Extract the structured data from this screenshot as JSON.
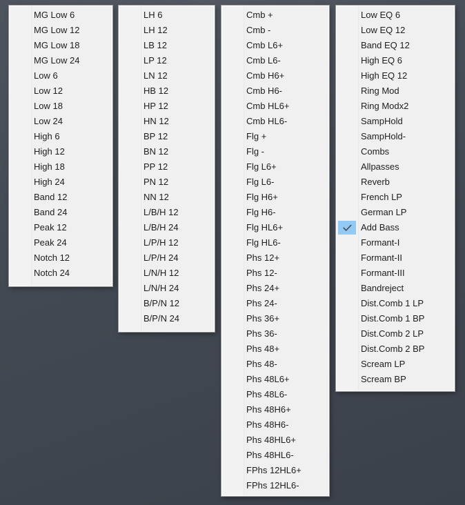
{
  "theme": {
    "background_color": "#434a53",
    "panel_background": "#f0f0f0",
    "panel_border": "#ffffff",
    "text_color": "#1d1d20",
    "check_highlight": "#91c9f7",
    "check_glyph_color": "#4a4a4a"
  },
  "menus": [
    {
      "name": "filters-basic",
      "items": [
        {
          "label": "MG Low 6",
          "checked": false
        },
        {
          "label": "MG Low 12",
          "checked": false
        },
        {
          "label": "MG Low 18",
          "checked": false
        },
        {
          "label": "MG Low 24",
          "checked": false
        },
        {
          "label": "Low 6",
          "checked": false
        },
        {
          "label": "Low 12",
          "checked": false
        },
        {
          "label": "Low 18",
          "checked": false
        },
        {
          "label": "Low 24",
          "checked": false
        },
        {
          "label": "High 6",
          "checked": false
        },
        {
          "label": "High 12",
          "checked": false
        },
        {
          "label": "High 18",
          "checked": false
        },
        {
          "label": "High 24",
          "checked": false
        },
        {
          "label": "Band 12",
          "checked": false
        },
        {
          "label": "Band 24",
          "checked": false
        },
        {
          "label": "Peak 12",
          "checked": false
        },
        {
          "label": "Peak 24",
          "checked": false
        },
        {
          "label": "Notch 12",
          "checked": false
        },
        {
          "label": "Notch 24",
          "checked": false
        }
      ]
    },
    {
      "name": "filters-multi",
      "items": [
        {
          "label": "LH 6",
          "checked": false
        },
        {
          "label": "LH 12",
          "checked": false
        },
        {
          "label": "LB 12",
          "checked": false
        },
        {
          "label": "LP 12",
          "checked": false
        },
        {
          "label": "LN 12",
          "checked": false
        },
        {
          "label": "HB 12",
          "checked": false
        },
        {
          "label": "HP 12",
          "checked": false
        },
        {
          "label": "HN 12",
          "checked": false
        },
        {
          "label": "BP 12",
          "checked": false
        },
        {
          "label": "BN 12",
          "checked": false
        },
        {
          "label": "PP 12",
          "checked": false
        },
        {
          "label": "PN 12",
          "checked": false
        },
        {
          "label": "NN 12",
          "checked": false
        },
        {
          "label": "L/B/H 12",
          "checked": false
        },
        {
          "label": "L/B/H 24",
          "checked": false
        },
        {
          "label": "L/P/H 12",
          "checked": false
        },
        {
          "label": "L/P/H 24",
          "checked": false
        },
        {
          "label": "L/N/H 12",
          "checked": false
        },
        {
          "label": "L/N/H 24",
          "checked": false
        },
        {
          "label": "B/P/N 12",
          "checked": false
        },
        {
          "label": "B/P/N 24",
          "checked": false
        }
      ]
    },
    {
      "name": "comb-phaser",
      "items": [
        {
          "label": "Cmb +",
          "checked": false
        },
        {
          "label": "Cmb -",
          "checked": false
        },
        {
          "label": "Cmb L6+",
          "checked": false
        },
        {
          "label": "Cmb L6-",
          "checked": false
        },
        {
          "label": "Cmb H6+",
          "checked": false
        },
        {
          "label": "Cmb H6-",
          "checked": false
        },
        {
          "label": "Cmb HL6+",
          "checked": false
        },
        {
          "label": "Cmb HL6-",
          "checked": false
        },
        {
          "label": "Flg +",
          "checked": false
        },
        {
          "label": "Flg -",
          "checked": false
        },
        {
          "label": "Flg L6+",
          "checked": false
        },
        {
          "label": "Flg L6-",
          "checked": false
        },
        {
          "label": "Flg H6+",
          "checked": false
        },
        {
          "label": "Flg H6-",
          "checked": false
        },
        {
          "label": "Flg HL6+",
          "checked": false
        },
        {
          "label": "Flg HL6-",
          "checked": false
        },
        {
          "label": "Phs 12+",
          "checked": false
        },
        {
          "label": "Phs 12-",
          "checked": false
        },
        {
          "label": "Phs 24+",
          "checked": false
        },
        {
          "label": "Phs 24-",
          "checked": false
        },
        {
          "label": "Phs 36+",
          "checked": false
        },
        {
          "label": "Phs 36-",
          "checked": false
        },
        {
          "label": "Phs 48+",
          "checked": false
        },
        {
          "label": "Phs 48-",
          "checked": false
        },
        {
          "label": "Phs 48L6+",
          "checked": false
        },
        {
          "label": "Phs 48L6-",
          "checked": false
        },
        {
          "label": "Phs 48H6+",
          "checked": false
        },
        {
          "label": "Phs 48H6-",
          "checked": false
        },
        {
          "label": "Phs 48HL6+",
          "checked": false
        },
        {
          "label": "Phs 48HL6-",
          "checked": false
        },
        {
          "label": "FPhs 12HL6+",
          "checked": false
        },
        {
          "label": "FPhs 12HL6-",
          "checked": false
        }
      ]
    },
    {
      "name": "effects",
      "items": [
        {
          "label": "Low EQ 6",
          "checked": false
        },
        {
          "label": "Low EQ 12",
          "checked": false
        },
        {
          "label": "Band EQ 12",
          "checked": false
        },
        {
          "label": "High EQ 6",
          "checked": false
        },
        {
          "label": "High EQ 12",
          "checked": false
        },
        {
          "label": "Ring Mod",
          "checked": false
        },
        {
          "label": "Ring Modx2",
          "checked": false
        },
        {
          "label": "SampHold",
          "checked": false
        },
        {
          "label": "SampHold-",
          "checked": false
        },
        {
          "label": "Combs",
          "checked": false
        },
        {
          "label": "Allpasses",
          "checked": false
        },
        {
          "label": "Reverb",
          "checked": false
        },
        {
          "label": "French LP",
          "checked": false
        },
        {
          "label": "German LP",
          "checked": false
        },
        {
          "label": "Add Bass",
          "checked": true
        },
        {
          "label": "Formant-I",
          "checked": false
        },
        {
          "label": "Formant-II",
          "checked": false
        },
        {
          "label": "Formant-III",
          "checked": false
        },
        {
          "label": "Bandreject",
          "checked": false
        },
        {
          "label": "Dist.Comb 1 LP",
          "checked": false
        },
        {
          "label": "Dist.Comb 1 BP",
          "checked": false
        },
        {
          "label": "Dist.Comb 2 LP",
          "checked": false
        },
        {
          "label": "Dist.Comb 2 BP",
          "checked": false
        },
        {
          "label": "Scream LP",
          "checked": false
        },
        {
          "label": "Scream BP",
          "checked": false
        }
      ]
    }
  ]
}
